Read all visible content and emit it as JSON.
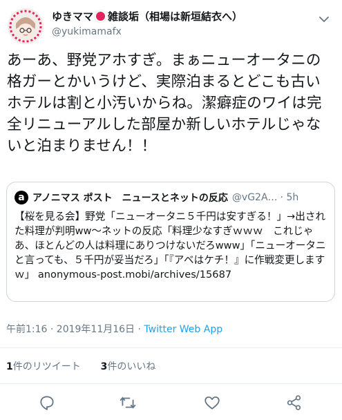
{
  "tweet": {
    "display_name": "ゆきママ",
    "display_name_suffix": "雑談垢（相場は新垣結衣へ）",
    "handle": "@yukimamafx",
    "text": "あーあ、野党アホすぎ。まぁニューオータニの格ガーとかいうけど、実際泊まるとどこも古いホテルは割と小汚いからね。潔癖症のワイは完全リニューアルした部屋か新しいホテルじゃないと泊まりません！！",
    "timestamp": "午前1:16 · 2019年11月16日 · ",
    "app": "Twitter Web App"
  },
  "quoted": {
    "logo_letter": "a",
    "name": "アノニマス ポスト　ニュースとネットの反応",
    "handle": "@vG2A…",
    "time": "· 5h",
    "text": "【桜を見る会】野党「ニューオータニ５千円は安すぎる！」→出された料理が判明ww〜ネットの反応「料理少なすぎｗｗｗ　これじゃあ、ほとんどの人は料理にありつけないだろwww」「ニューオータニと言っても、５千円が妥当だろ」「『アベはケチ！』に作戦変更しますｗ」 anonymous-post.mobi/archives/15687"
  },
  "stats": {
    "retweet_count": "1",
    "retweet_label": "件のリツイート",
    "like_count": "3",
    "like_label": "件のいいね"
  },
  "icons": {
    "reply": "reply-icon",
    "retweet": "retweet-icon",
    "like": "heart-icon",
    "share": "share-icon",
    "more": "chevron-down-icon"
  },
  "colors": {
    "accent": "#1da1f2",
    "secondary_text": "#657786",
    "flag_red": "#e0245e"
  }
}
